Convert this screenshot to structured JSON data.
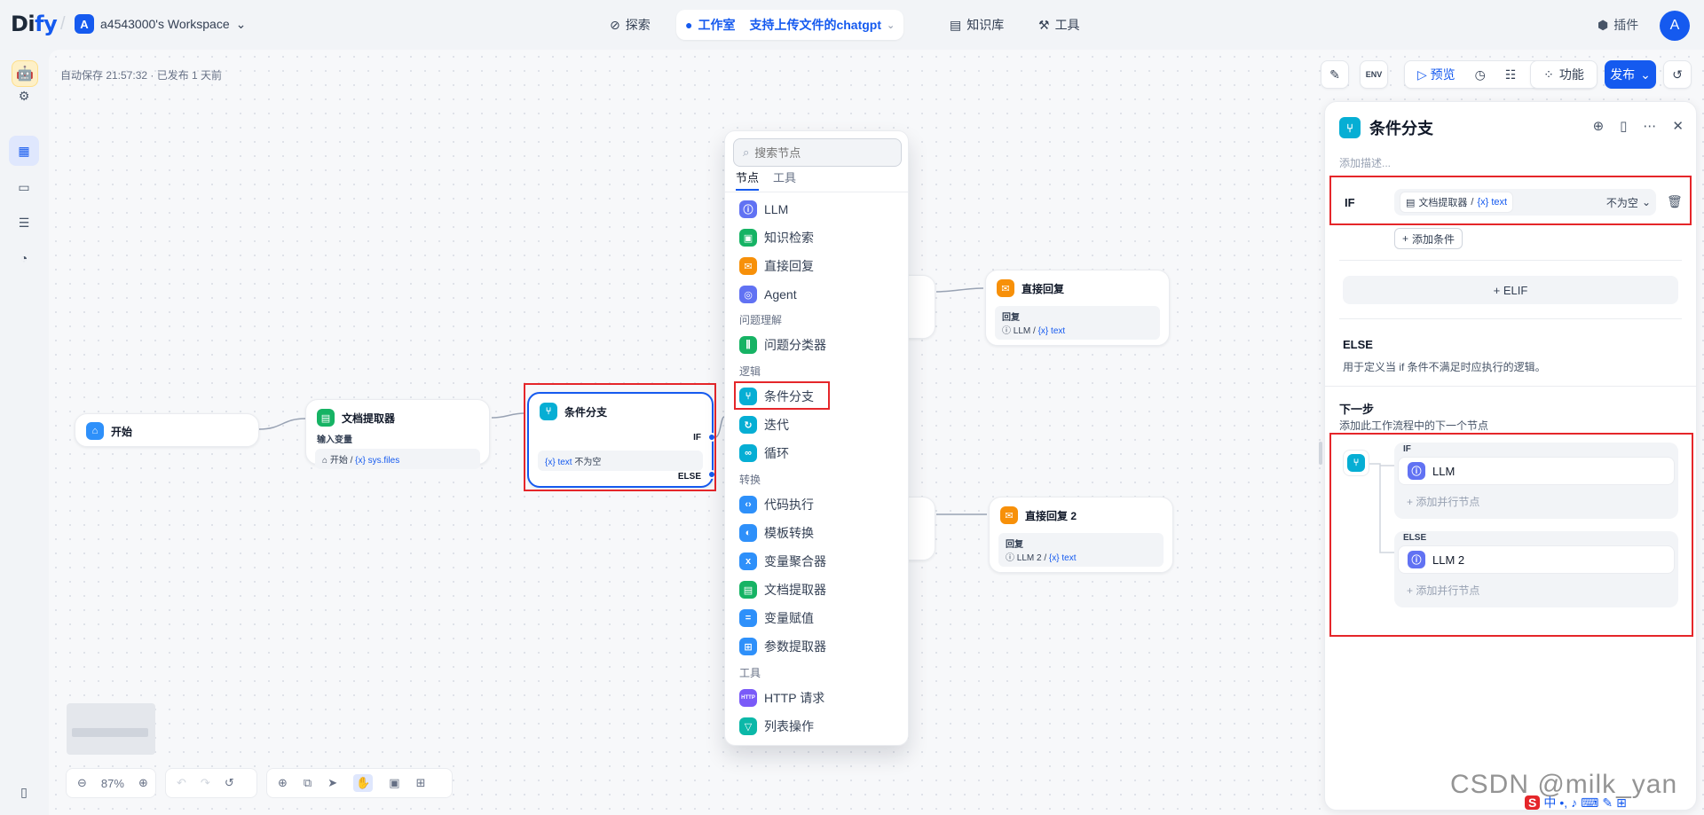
{
  "header": {
    "logo_prefix": "Di",
    "logo_suffix": "fy",
    "workspace_initial": "A",
    "workspace_name": "a4543000's Workspace",
    "nav_explore": "探索",
    "nav_studio": "工作室",
    "app_name": "支持上传文件的chatgpt",
    "nav_knowledge": "知识库",
    "nav_tools": "工具",
    "plugins": "插件",
    "user_initial": "A"
  },
  "toolbar": {
    "autosave": "自动保存 21:57:32 · 已发布 1 天前",
    "env": "ENV",
    "preview": "预览",
    "features": "功能",
    "publish": "发布"
  },
  "canvas": {
    "start_title": "开始",
    "doc_title": "文档提取器",
    "doc_input_label": "输入变量",
    "doc_input_src": "开始",
    "doc_input_var": "{x} sys.files",
    "if_title": "条件分支",
    "if_port": "IF",
    "else_port": "ELSE",
    "if_cond_var": "{x}  text",
    "if_cond_op": "不为空",
    "reply1_title": "直接回复",
    "reply1_label": "回复",
    "reply1_src": "LLM",
    "reply1_var": "{x} text",
    "reply2_title": "直接回复 2",
    "reply2_label": "回复",
    "reply2_src": "LLM 2",
    "reply2_var": "{x} text",
    "zoom": "87%"
  },
  "picker": {
    "search_placeholder": "搜索节点",
    "tab_nodes": "节点",
    "tab_tools": "工具",
    "items_top": [
      "LLM",
      "知识检索",
      "直接回复",
      "Agent"
    ],
    "cat_understanding": "问题理解",
    "item_classifier": "问题分类器",
    "cat_logic": "逻辑",
    "items_logic": [
      "条件分支",
      "迭代",
      "循环"
    ],
    "cat_transform": "转换",
    "items_transform": [
      "代码执行",
      "模板转换",
      "变量聚合器",
      "文档提取器",
      "变量赋值",
      "参数提取器"
    ],
    "cat_tools": "工具",
    "items_tools": [
      "HTTP 请求",
      "列表操作"
    ]
  },
  "panel": {
    "title": "条件分支",
    "description_placeholder": "添加描述...",
    "if_label": "IF",
    "cond_node": "文档提取器",
    "cond_var": "{x} text",
    "cond_op": "不为空",
    "add_condition": "添加条件",
    "elif": "+ ELIF",
    "else_title": "ELSE",
    "else_desc": "用于定义当 if 条件不满足时应执行的逻辑。",
    "next_title": "下一步",
    "next_desc": "添加此工作流程中的下一个节点",
    "branch_if": "IF",
    "branch_if_node": "LLM",
    "branch_else": "ELSE",
    "branch_else_node": "LLM 2",
    "add_parallel": "添加并行节点"
  },
  "watermark": "CSDN @milk_yan",
  "colors": {
    "accent": "#155aef",
    "highlight": "#e5262a",
    "if_node": "#06aed4"
  }
}
